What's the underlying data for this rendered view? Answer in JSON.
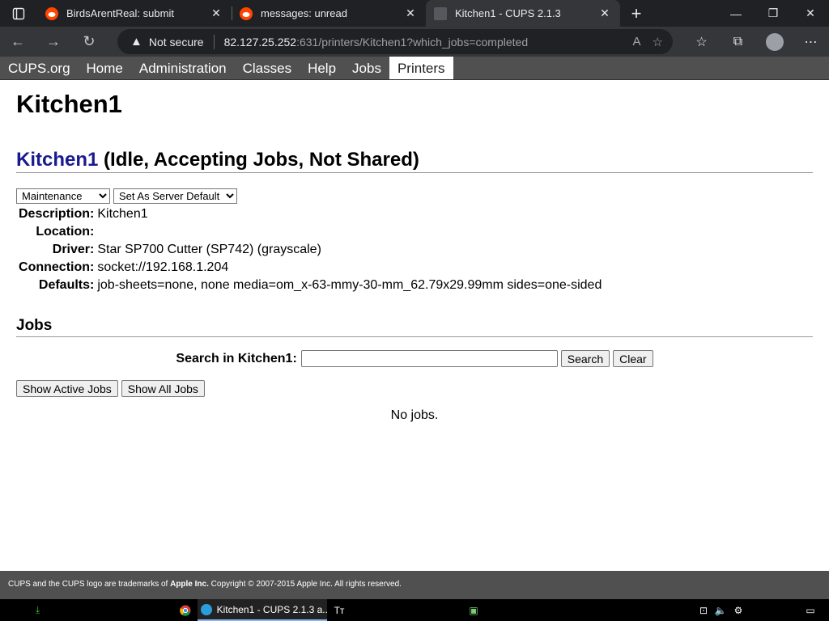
{
  "browser": {
    "tabs": [
      {
        "title": "BirdsArentReal: submit",
        "icon": "reddit-icon",
        "active": false
      },
      {
        "title": "messages: unread",
        "icon": "reddit-icon",
        "active": false
      },
      {
        "title": "Kitchen1 - CUPS 2.1.3",
        "icon": "cups-icon",
        "active": true
      }
    ],
    "security_label": "Not secure",
    "url_host": "82.127.25.252",
    "url_path": ":631/printers/Kitchen1?which_jobs=completed"
  },
  "cups_nav": {
    "items": [
      "CUPS.org",
      "Home",
      "Administration",
      "Classes",
      "Help",
      "Jobs",
      "Printers"
    ],
    "active": "Printers"
  },
  "page": {
    "title": "Kitchen1",
    "printer_link": "Kitchen1",
    "printer_status": " (Idle, Accepting Jobs, Not Shared)",
    "maintenance_select": "Maintenance",
    "admin_select": "Set As Server Default",
    "info": [
      {
        "label": "Description:",
        "value": "Kitchen1"
      },
      {
        "label": "Location:",
        "value": ""
      },
      {
        "label": "Driver:",
        "value": "Star SP700 Cutter (SP742) (grayscale)"
      },
      {
        "label": "Connection:",
        "value": "socket://192.168.1.204"
      },
      {
        "label": "Defaults:",
        "value": "job-sheets=none, none media=om_x-63-mmy-30-mm_62.79x29.99mm sides=one-sided"
      }
    ],
    "jobs_heading": "Jobs",
    "search_label": "Search in Kitchen1:",
    "search_value": "",
    "search_button": "Search",
    "clear_button": "Clear",
    "show_active_button": "Show Active Jobs",
    "show_all_button": "Show All Jobs",
    "no_jobs": "No jobs."
  },
  "footer": {
    "text_pre": "CUPS and the CUPS logo are trademarks of ",
    "text_bold": "Apple Inc.",
    "text_post": " Copyright © 2007-2015 Apple Inc. All rights reserved."
  },
  "taskbar": {
    "edge_window_title": "Kitchen1 - CUPS 2.1.3 a..."
  }
}
